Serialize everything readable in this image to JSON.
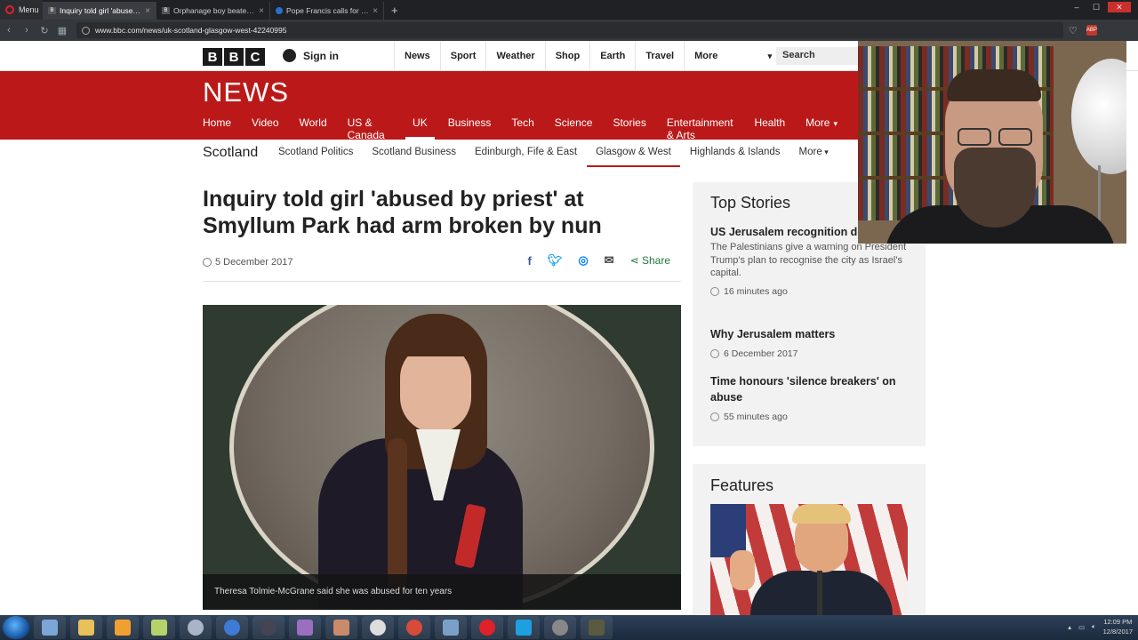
{
  "browser": {
    "menu_label": "Menu",
    "tabs": [
      {
        "title": "Inquiry told girl 'abused b",
        "active": true
      },
      {
        "title": "Orphanage boy beaten af",
        "active": false
      },
      {
        "title": "Pope Francis calls for Lord",
        "active": false
      }
    ],
    "url": "www.bbc.com/news/uk-scotland-glasgow-west-42240995"
  },
  "bbc": {
    "logo": [
      "B",
      "B",
      "C"
    ],
    "signin": "Sign in",
    "topnav": [
      "News",
      "Sport",
      "Weather",
      "Shop",
      "Earth",
      "Travel"
    ],
    "topnav_more": "More",
    "search_placeholder": "Search"
  },
  "news": {
    "wordmark": "NEWS",
    "nav": [
      "Home",
      "Video",
      "World",
      "US & Canada",
      "UK",
      "Business",
      "Tech",
      "Science",
      "Stories",
      "Entertainment & Arts",
      "Health",
      "More"
    ],
    "active_nav": "UK"
  },
  "subnav": {
    "title": "Scotland",
    "items": [
      "Scotland Politics",
      "Scotland Business",
      "Edinburgh, Fife & East",
      "Glasgow & West",
      "Highlands & Islands",
      "More"
    ],
    "active": "Glasgow & West"
  },
  "article": {
    "headline": "Inquiry told girl 'abused by priest' at Smyllum Park had arm broken by nun",
    "date": "5 December 2017",
    "share_label": "Share",
    "caption": "Theresa Tolmie-McGrane said she was abused for ten years"
  },
  "sidebar": {
    "top_stories_title": "Top Stories",
    "stories": [
      {
        "headline": "US Jerusalem recognition death'",
        "summary": "The Palestinians give a warning on President Trump's plan to recognise the city as Israel's capital.",
        "time": "16 minutes ago"
      },
      {
        "headline": "Why Jerusalem matters",
        "summary": "",
        "time": "6 December 2017"
      },
      {
        "headline": "Time honours 'silence breakers' on abuse",
        "summary": "",
        "time": "55 minutes ago"
      }
    ],
    "features_title": "Features"
  },
  "taskbar": {
    "time": "12:09 PM",
    "date": "12/8/2017"
  },
  "colors": {
    "bbc_red": "#bb1919",
    "chrome_dark": "#1f2125"
  }
}
